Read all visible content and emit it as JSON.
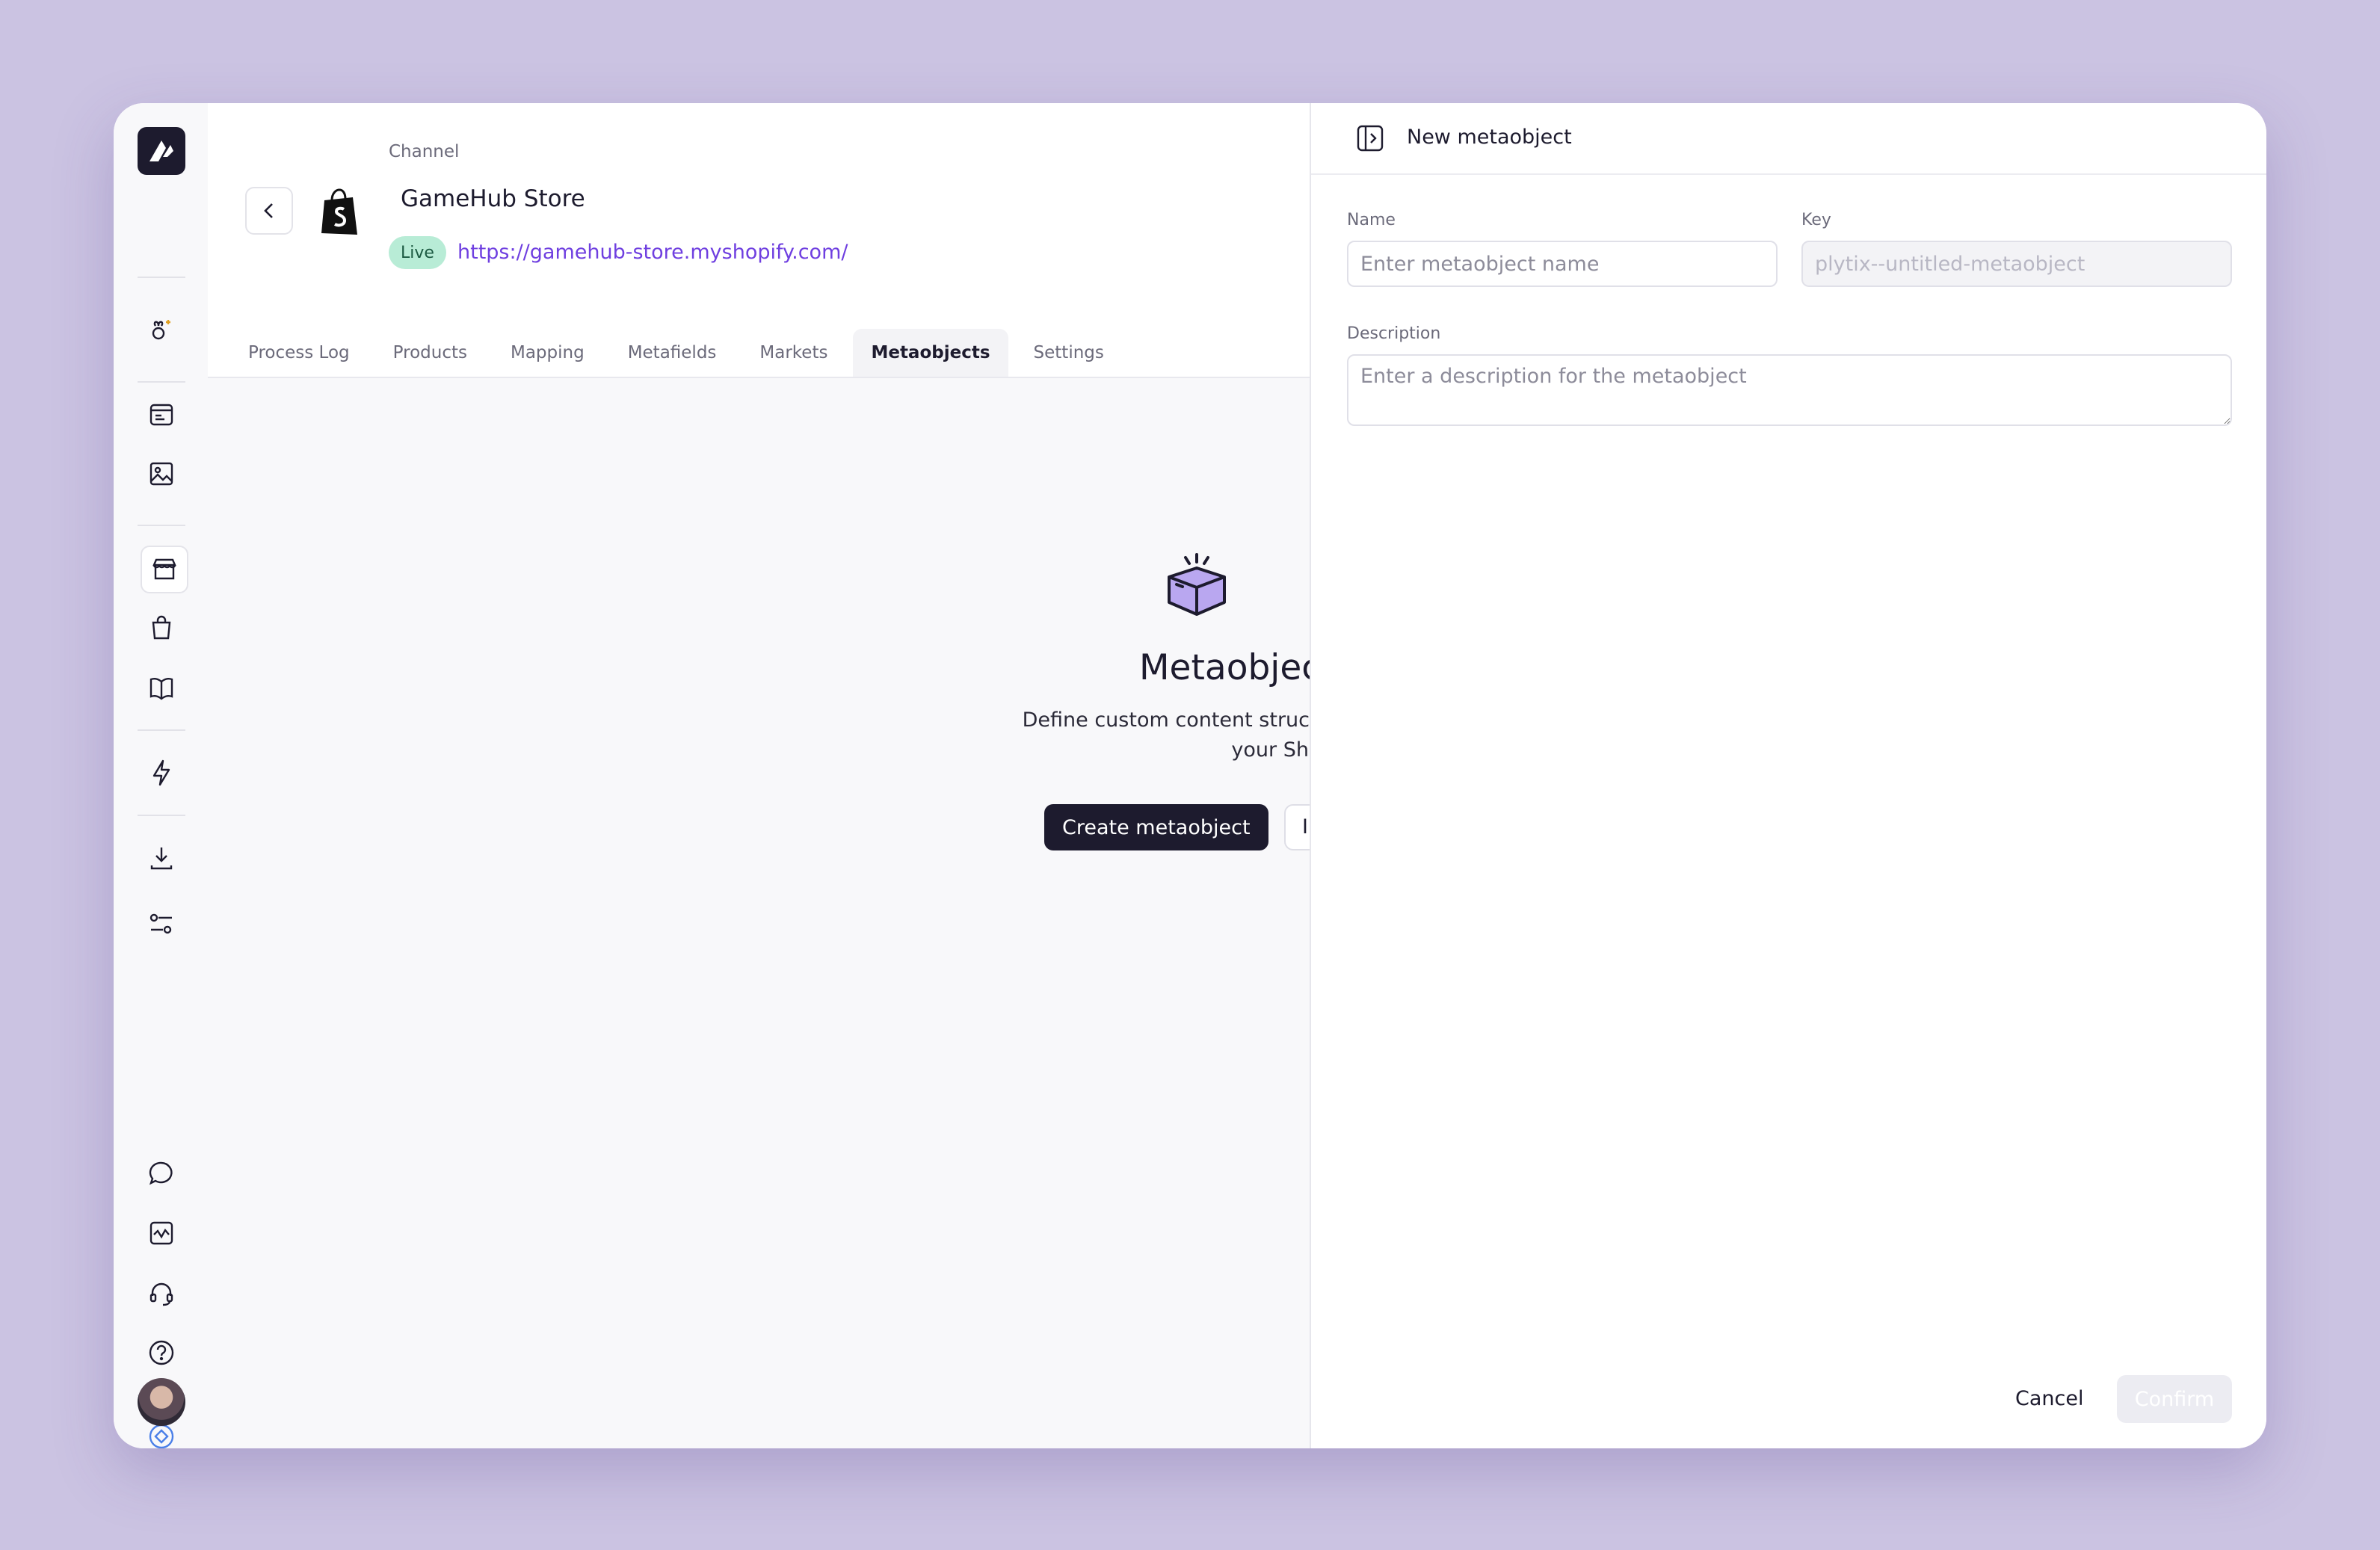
{
  "sidebar": {
    "icons": [
      "logo-icon",
      "sparkle-bee-icon",
      "catalog-icon",
      "image-icon",
      "store-icon",
      "bag-icon",
      "book-icon",
      "lightning-icon",
      "download-icon",
      "sliders-icon",
      "chat-icon",
      "activity-icon",
      "headset-icon",
      "help-icon",
      "badge-icon",
      "avatar"
    ]
  },
  "header": {
    "channel_label": "Channel",
    "store_name": "GameHub Store",
    "status": "Live",
    "url": "https://gamehub-store.myshopify.com/"
  },
  "tabs": [
    {
      "label": "Process Log",
      "active": false
    },
    {
      "label": "Products",
      "active": false
    },
    {
      "label": "Mapping",
      "active": false
    },
    {
      "label": "Metafields",
      "active": false
    },
    {
      "label": "Markets",
      "active": false
    },
    {
      "label": "Metaobjects",
      "active": true
    },
    {
      "label": "Settings",
      "active": false
    }
  ],
  "empty_state": {
    "title": "Metaobjec",
    "description_line1": "Define custom content structures anc",
    "description_line2": "your Shopify stor",
    "primary_button": "Create metaobject",
    "secondary_button": "I"
  },
  "drawer": {
    "title": "New metaobject",
    "name_label": "Name",
    "name_placeholder": "Enter metaobject name",
    "key_label": "Key",
    "key_placeholder": "plytix--untitled-metaobject",
    "description_label": "Description",
    "description_placeholder": "Enter a description for the metaobject",
    "cancel_label": "Cancel",
    "confirm_label": "Confirm"
  },
  "colors": {
    "background": "#cbc3e2",
    "accent": "#6f3fe0",
    "live_badge_bg": "#b8ecd6",
    "live_badge_text": "#1c5a42",
    "dark": "#1d1b2e"
  }
}
